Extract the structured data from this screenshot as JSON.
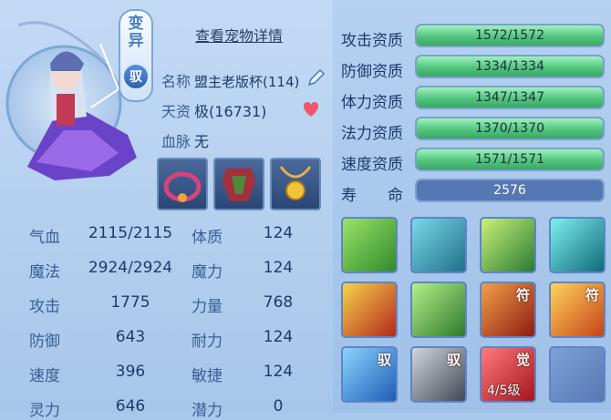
{
  "badges": {
    "mutant": "变异",
    "tamed": "驭"
  },
  "detail_link": "查看宠物详情",
  "info": {
    "name_label": "名称",
    "name_value": "盟主老版杯(114)",
    "talent_label": "天资",
    "talent_value": "极(16731)",
    "bloodline_label": "血脉",
    "bloodline_value": "无"
  },
  "equipment": [
    {
      "icon": "ring-collar-icon"
    },
    {
      "icon": "armor-icon"
    },
    {
      "icon": "amulet-icon"
    }
  ],
  "stats": [
    {
      "label": "气血",
      "value": "2115/2115",
      "label2": "体质",
      "value2": "124"
    },
    {
      "label": "魔法",
      "value": "2924/2924",
      "label2": "魔力",
      "value2": "124"
    },
    {
      "label": "攻击",
      "value": "1775",
      "label2": "力量",
      "value2": "768"
    },
    {
      "label": "防御",
      "value": "643",
      "label2": "耐力",
      "value2": "124"
    },
    {
      "label": "速度",
      "value": "396",
      "label2": "敏捷",
      "value2": "124"
    },
    {
      "label": "灵力",
      "value": "646",
      "label2": "潜力",
      "value2": "0"
    }
  ],
  "aptitudes": [
    {
      "label": "攻击资质",
      "value": "1572/1572",
      "fill": 1.0
    },
    {
      "label": "防御资质",
      "value": "1334/1334",
      "fill": 1.0
    },
    {
      "label": "体力资质",
      "value": "1347/1347",
      "fill": 1.0
    },
    {
      "label": "法力资质",
      "value": "1370/1370",
      "fill": 1.0
    },
    {
      "label": "速度资质",
      "value": "1571/1571",
      "fill": 1.0
    },
    {
      "label": "寿　　命",
      "value": "2576",
      "fill": 0.0
    }
  ],
  "skills": [
    {
      "icon": "shadow-strike-icon",
      "tag": "",
      "level": ""
    },
    {
      "icon": "spirit-icon",
      "tag": "",
      "level": ""
    },
    {
      "icon": "moon-warrior-icon",
      "tag": "",
      "level": ""
    },
    {
      "icon": "blue-flame-icon",
      "tag": "",
      "level": ""
    },
    {
      "icon": "scroll-shield-icon",
      "tag": "",
      "level": ""
    },
    {
      "icon": "giant-icon",
      "tag": "",
      "level": ""
    },
    {
      "icon": "fire-demon-icon",
      "tag": "符",
      "level": ""
    },
    {
      "icon": "flame-sword-icon",
      "tag": "符",
      "level": ""
    },
    {
      "icon": "wave-strike-icon",
      "tag": "驭",
      "level": ""
    },
    {
      "icon": "blade-icon",
      "tag": "驭",
      "level": ""
    },
    {
      "icon": "awaken-icon",
      "tag": "觉",
      "level": "4/5级"
    },
    {
      "icon": "empty-slot",
      "tag": "",
      "level": ""
    }
  ]
}
